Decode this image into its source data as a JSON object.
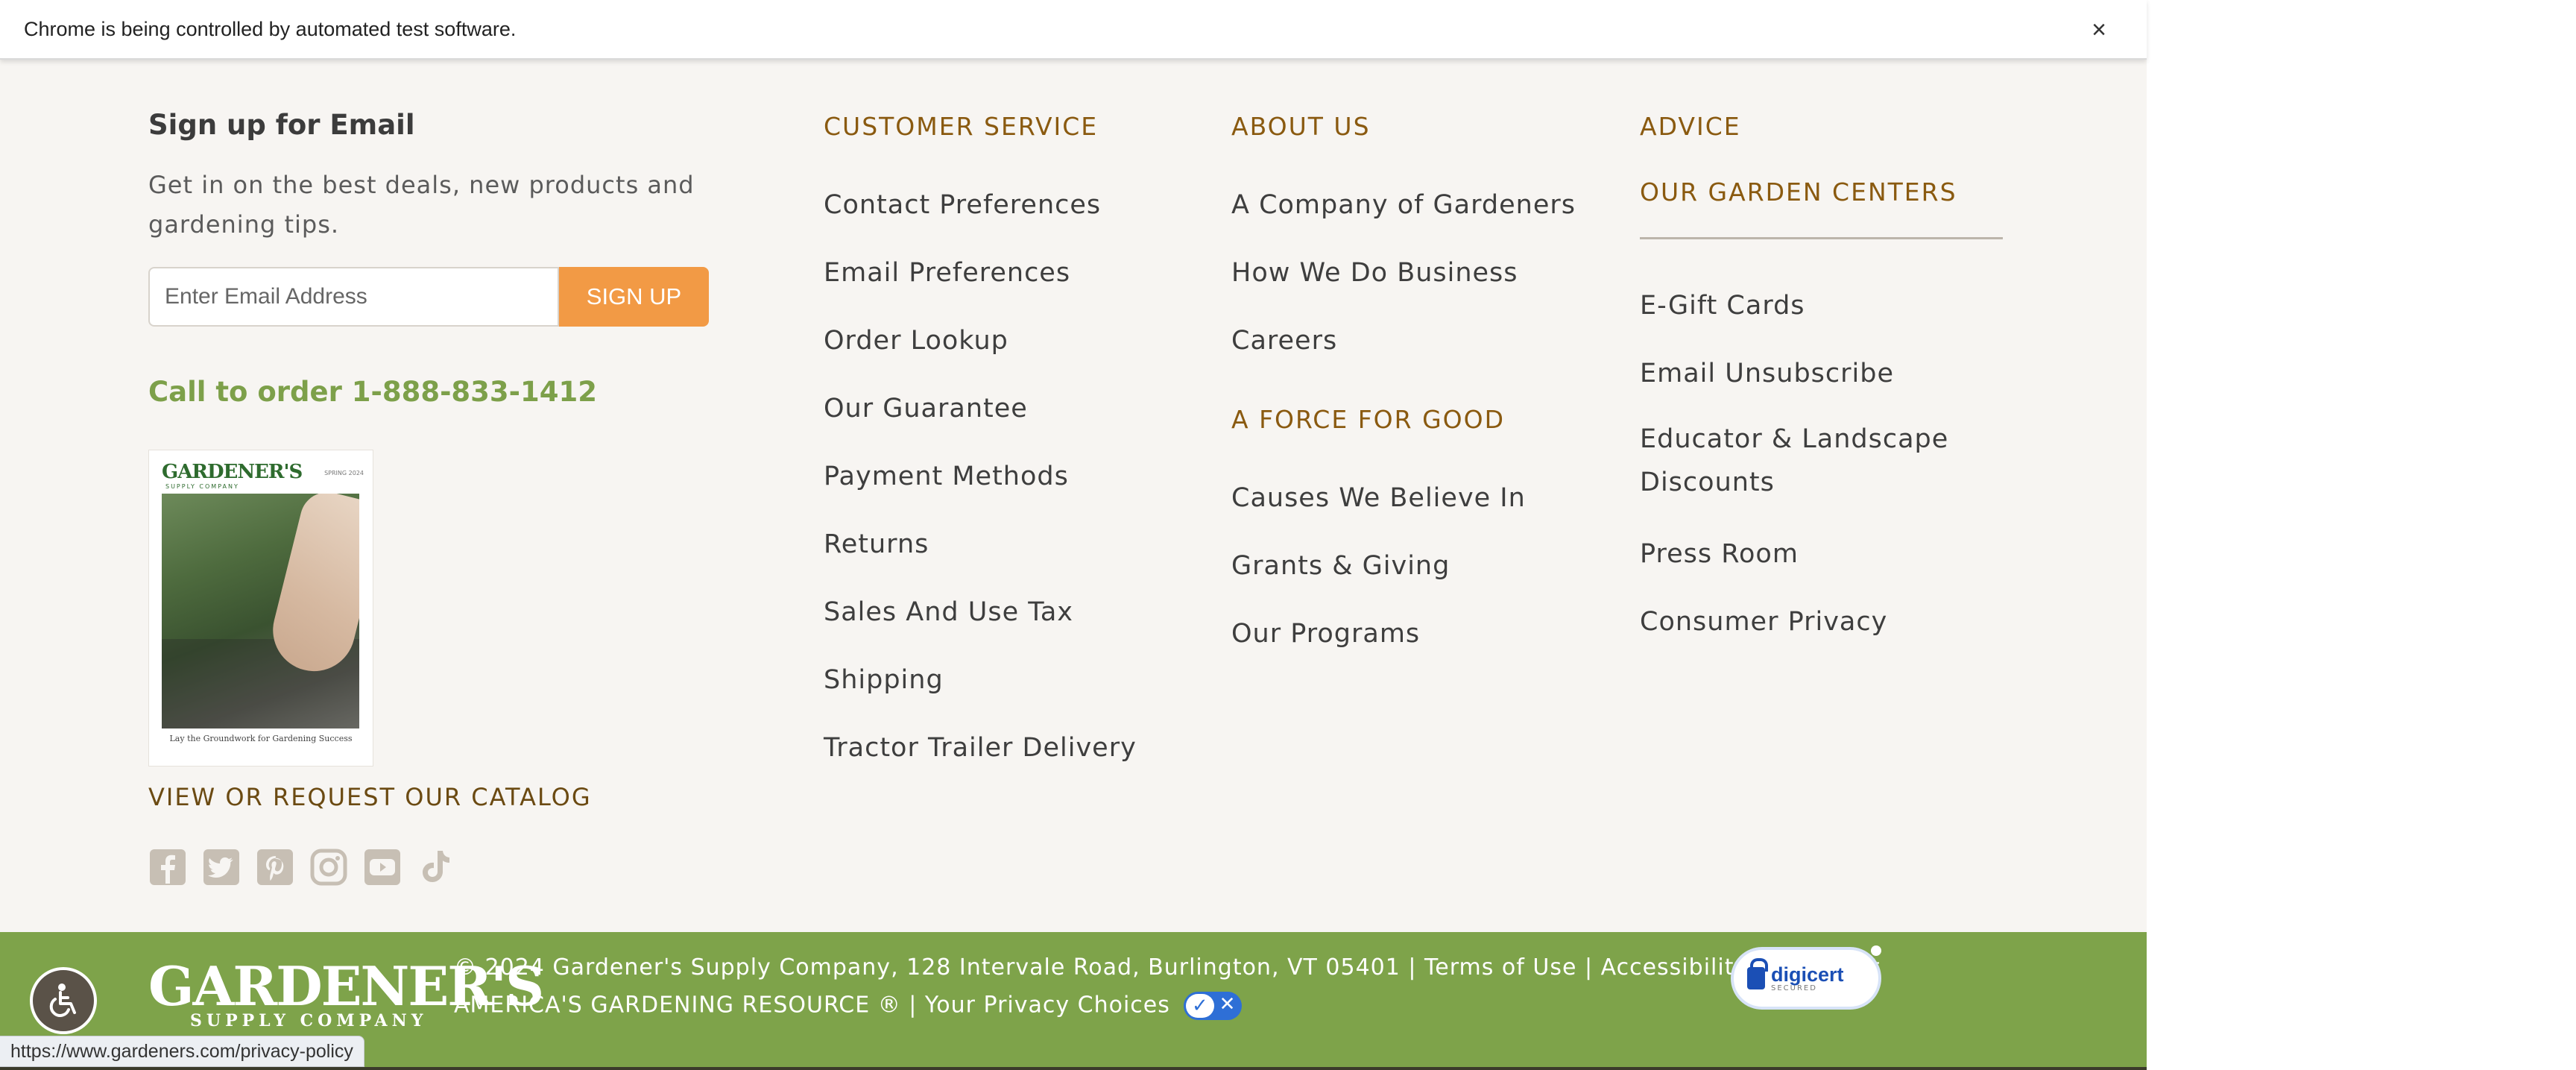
{
  "automation_bar": {
    "message": "Chrome is being controlled by automated test software.",
    "close_glyph": "×"
  },
  "signup": {
    "title": "Sign up for Email",
    "description": "Get in on the best deals, new products and gardening tips.",
    "email_placeholder": "Enter Email Address",
    "email_value": "",
    "button_label": "SIGN UP",
    "accent_color": "#f29a45"
  },
  "call_to_order": "Call to order 1-888-833-1412",
  "catalog": {
    "logo_text": "GARDENER'S",
    "caption": "Lay the Groundwork for Gardening Success",
    "link_label": "VIEW OR REQUEST OUR CATALOG"
  },
  "social_icons": [
    "facebook-icon",
    "twitter-icon",
    "pinterest-icon",
    "instagram-icon",
    "youtube-icon",
    "tiktok-icon"
  ],
  "customer_service": {
    "heading": "CUSTOMER SERVICE",
    "links": [
      "Contact Preferences",
      "Email Preferences",
      "Order Lookup",
      "Our Guarantee",
      "Payment Methods",
      "Returns",
      "Sales And Use Tax",
      "Shipping",
      "Tractor Trailer Delivery"
    ]
  },
  "about_us": {
    "heading": "ABOUT US",
    "links": [
      "A Company of Gardeners",
      "How We Do Business",
      "Careers"
    ]
  },
  "force_for_good": {
    "heading": "A FORCE FOR GOOD",
    "links": [
      "Causes We Believe In",
      "Grants & Giving",
      "Our Programs"
    ]
  },
  "advice": {
    "heading": "ADVICE"
  },
  "garden_centers": {
    "heading": "OUR GARDEN CENTERS"
  },
  "misc_links": [
    "E-Gift Cards",
    "Email Unsubscribe",
    "Educator & Landscape Discounts",
    "Press Room",
    "Consumer Privacy"
  ],
  "bottom_bar": {
    "brand_name": "GARDENER'S",
    "brand_sub": "SUPPLY COMPANY",
    "copyright": "© 2024 Gardener's Supply Company, 128 Intervale Road, Burlington, VT 05401 | ",
    "terms_label": "Terms of Use",
    "separator": " | ",
    "accessibility_label": "Accessibility Statement",
    "tagline": "AMERICA'S GARDENING RESOURCE ® | ",
    "privacy_choices_label": "Your Privacy Choices",
    "digicert_name": "digicert",
    "digicert_sub": "SECURED",
    "background_color": "#7ea34a"
  },
  "status_url": "https://www.gardeners.com/privacy-policy",
  "colors": {
    "heading_brown": "#8a5a10",
    "link_gray": "#3e3e3e",
    "green": "#7da04a",
    "footer_bg": "#f7f5f2"
  }
}
